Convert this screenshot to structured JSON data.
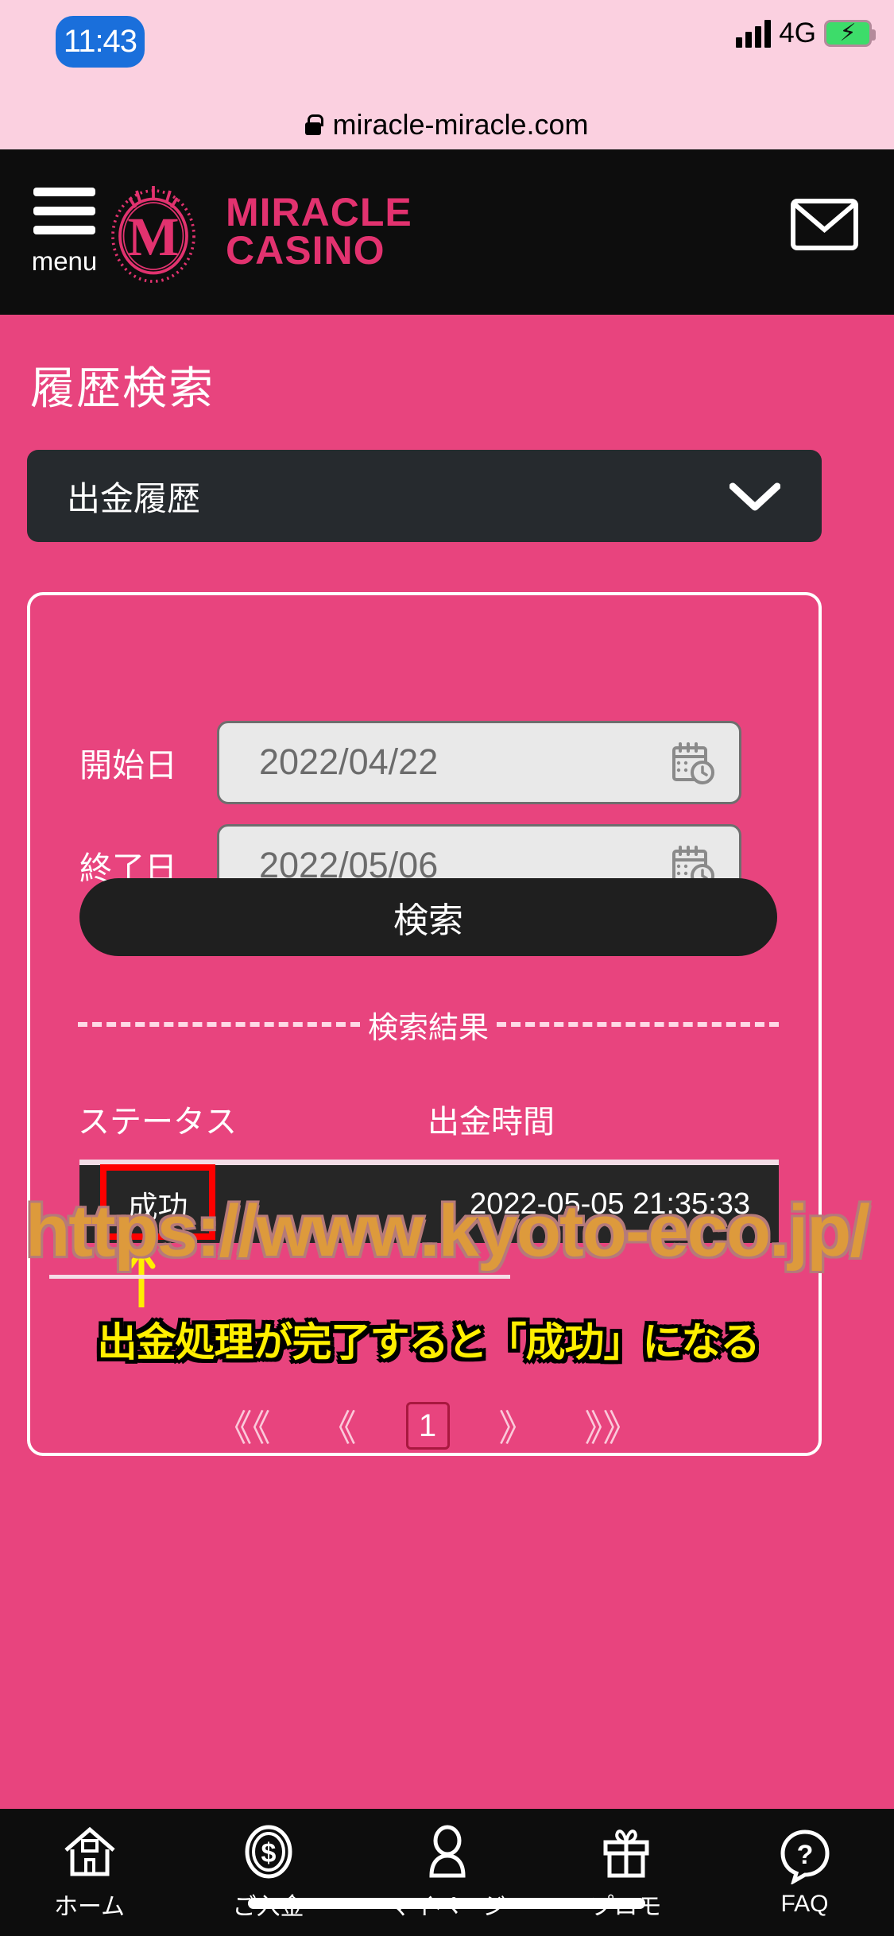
{
  "status_bar": {
    "time": "11:43",
    "network": "4G",
    "signal_icon": "signal-bars-icon",
    "battery_icon": "battery-charging-icon"
  },
  "url_bar": {
    "lock_icon": "lock-icon",
    "url": "miracle-miracle.com"
  },
  "header": {
    "menu_label": "menu",
    "menu_icon": "hamburger-icon",
    "logo_line1": "MIRACLE",
    "logo_line2": "CASINO",
    "logo_icon": "miracle-casino-emblem-icon",
    "mail_icon": "envelope-icon"
  },
  "page": {
    "title": "履歴検索",
    "history_type_select": {
      "value": "出金履歴",
      "chevron_icon": "chevron-down-icon"
    },
    "form": {
      "start_label": "開始日",
      "start_value": "2022/04/22",
      "end_label": "終了日",
      "end_value": "2022/05/06",
      "calendar_icon": "calendar-clock-icon",
      "search_button": "検索"
    },
    "results": {
      "divider_label": "検索結果",
      "columns": [
        "ステータス",
        "出金時間"
      ],
      "rows": [
        {
          "status": "成功",
          "time": "2022-05-05 21:35:33"
        }
      ]
    },
    "annotation": {
      "text": "出金処理が完了すると「成功」になる",
      "arrow_icon": "arrow-up-icon",
      "highlight_color": "#ff0000",
      "text_color": "#ffef00"
    },
    "pagination": {
      "first": "《《",
      "prev": "《",
      "current": "1",
      "next": "》",
      "last": "》》"
    },
    "watermark": "https://www.kyoto-eco.jp/",
    "support_icon": "headset-icon"
  },
  "bottom_nav": [
    {
      "label": "ホーム",
      "icon": "home-icon"
    },
    {
      "label": "ご入金",
      "icon": "dollar-coin-icon"
    },
    {
      "label": "マイページ",
      "icon": "person-icon"
    },
    {
      "label": "プロモ",
      "icon": "gift-icon"
    },
    {
      "label": "FAQ",
      "icon": "question-bubble-icon"
    }
  ],
  "colors": {
    "brand_pink": "#e8447e",
    "header_black": "#0d0d0d",
    "status_bg": "#fbd0e0",
    "logo_pink": "#e2326f"
  }
}
